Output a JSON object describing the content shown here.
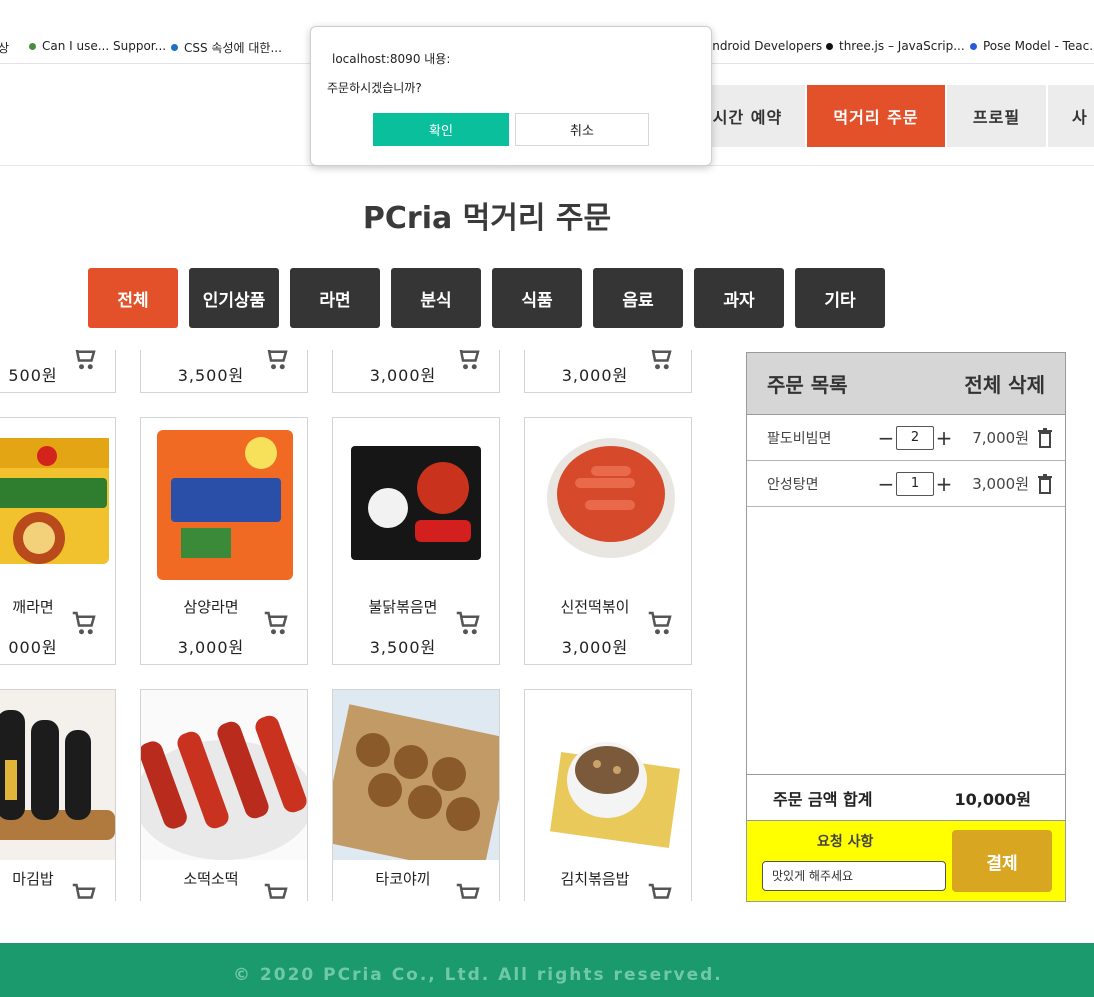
{
  "bookmarks": [
    {
      "label": "Can I use... Suppor...",
      "color": "#4a8c3f"
    },
    {
      "label": "CSS 속성에 대한...",
      "color": "#1f6fc4"
    },
    {
      "label": "Android Developers",
      "color": "#3ddc84"
    },
    {
      "label": "three.js – JavaScrip...",
      "color": "#111111"
    },
    {
      "label": "Pose Model - Teac...",
      "color": "#2a5bd7"
    }
  ],
  "nav": {
    "items": [
      {
        "label": "시간 예약"
      },
      {
        "label": "먹거리 주문",
        "active": true
      },
      {
        "label": "프로필"
      },
      {
        "label": "사"
      }
    ]
  },
  "page": {
    "title": "PCria 먹거리 주문"
  },
  "categories": [
    "전체",
    "인기상품",
    "라면",
    "분식",
    "식품",
    "음료",
    "과자",
    "기타"
  ],
  "products": {
    "row1": [
      {
        "price": "500원"
      },
      {
        "price": "3,500원"
      },
      {
        "price": "3,000원"
      },
      {
        "price": "3,000원"
      }
    ],
    "row2": [
      {
        "name": "깨라면",
        "price": "000원"
      },
      {
        "name": "삼양라면",
        "price": "3,000원"
      },
      {
        "name": "불닭볶음면",
        "price": "3,500원"
      },
      {
        "name": "신전떡볶이",
        "price": "3,000원"
      }
    ],
    "row3": [
      {
        "name": "마김밥"
      },
      {
        "name": "소떡소떡"
      },
      {
        "name": "타코야끼"
      },
      {
        "name": "김치볶음밥"
      }
    ]
  },
  "order": {
    "title": "주문 목록",
    "clear_all": "전체 삭제",
    "items": [
      {
        "name": "팔도비빔면",
        "qty": "2",
        "price": "7,000원"
      },
      {
        "name": "안성탕면",
        "qty": "1",
        "price": "3,000원"
      }
    ],
    "total_label": "주문 금액 합계",
    "total_value": "10,000원",
    "request_label": "요청 사항",
    "request_value": "맛있게 해주세요",
    "pay_label": "결제"
  },
  "footer": {
    "text": "© 2020 PCria Co., Ltd. All rights reserved."
  },
  "dialog": {
    "title": "localhost:8090 내용:",
    "message": "주문하시겠습니까?",
    "ok_label": "확인",
    "cancel_label": "취소"
  },
  "colors": {
    "accent": "#e2512a",
    "dark_button": "#353535",
    "footer": "#1b9a6e",
    "pay": "#d8a620",
    "dialog_ok": "#0abf9c",
    "request_bg": "#ffff00"
  }
}
